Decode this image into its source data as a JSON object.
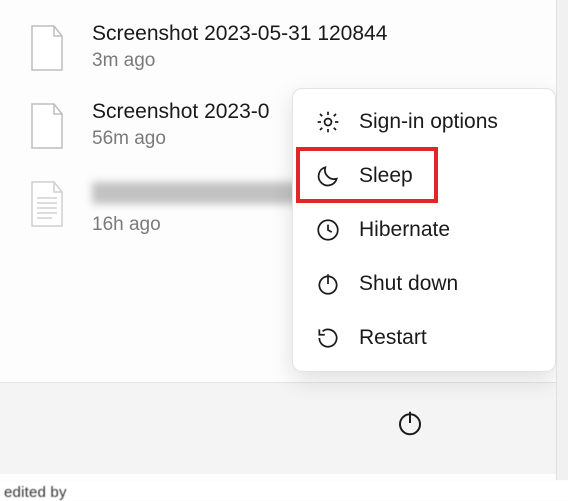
{
  "files": [
    {
      "name": "Screenshot 2023-05-31 120844",
      "time": "3m ago",
      "kind": "blank"
    },
    {
      "name": "Screenshot 2023-0",
      "time": "56m ago",
      "kind": "blank"
    },
    {
      "name": "",
      "time": "16h ago",
      "kind": "lined",
      "redacted": true
    }
  ],
  "power_menu": {
    "items": [
      {
        "icon": "gear-icon",
        "label": "Sign-in options"
      },
      {
        "icon": "moon-icon",
        "label": "Sleep",
        "highlighted": true
      },
      {
        "icon": "clock-icon",
        "label": "Hibernate"
      },
      {
        "icon": "power-icon",
        "label": "Shut down"
      },
      {
        "icon": "restart-icon",
        "label": "Restart"
      }
    ]
  },
  "highlight_color": "#e0262a",
  "cropped_footer": "edited by"
}
